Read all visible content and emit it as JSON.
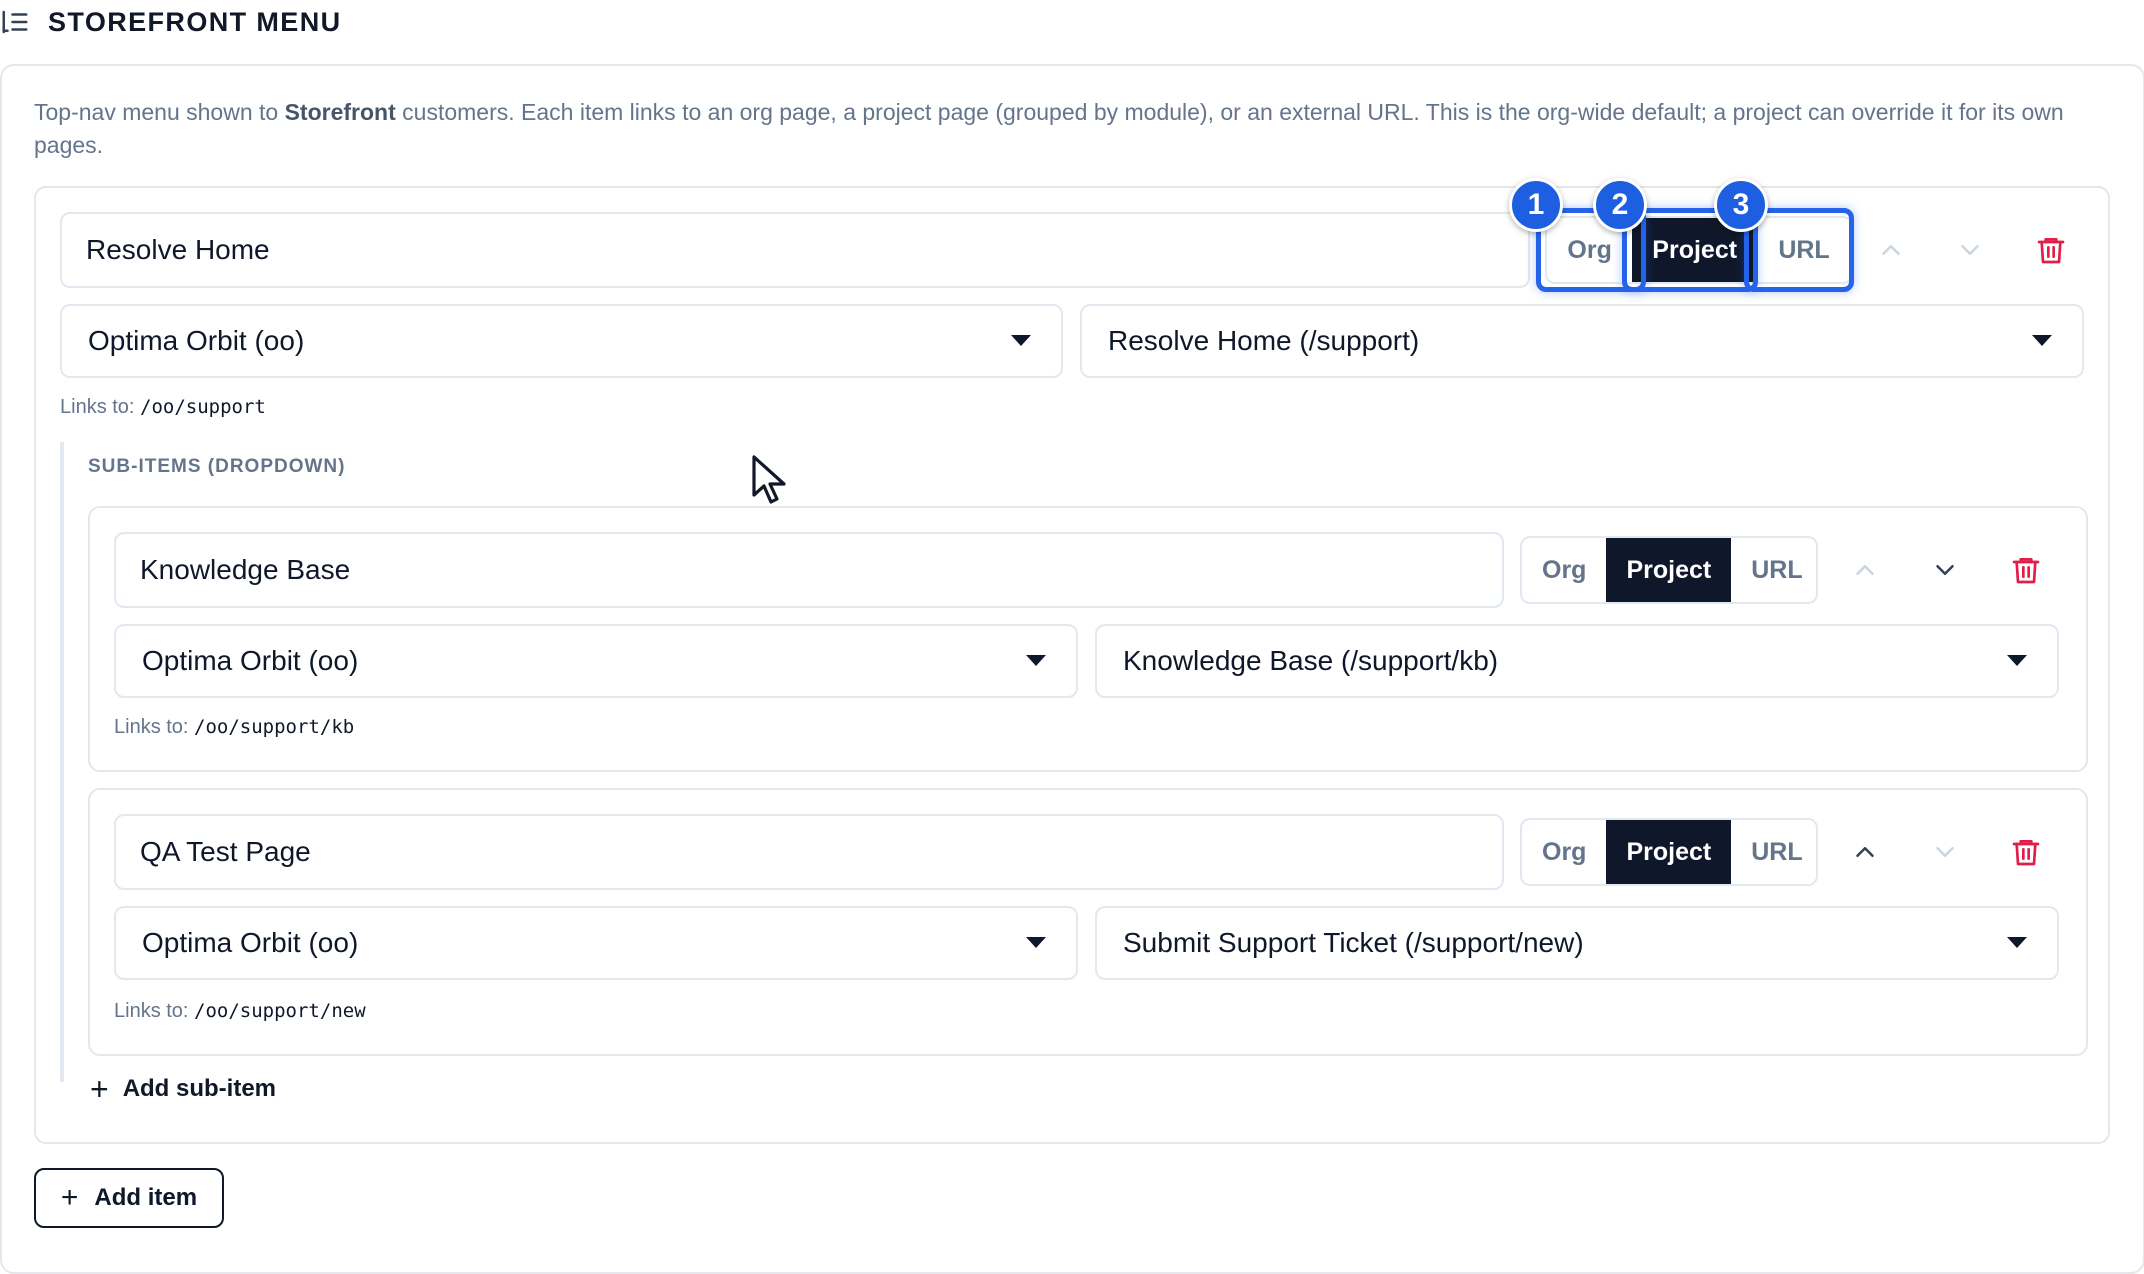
{
  "header": {
    "title": "STOREFRONT MENU",
    "icon": "list-indent-icon"
  },
  "description": {
    "before": "Top-nav menu shown to ",
    "bold": "Storefront",
    "after": " customers. Each item links to an org page, a project page (grouped by module), or an external URL. This is the org-wide default; a project can override it for its own pages."
  },
  "toggle_options": {
    "org": "Org",
    "project": "Project",
    "url": "URL"
  },
  "items": [
    {
      "label_value": "Resolve Home",
      "project_select": "Optima Orbit (oo)",
      "page_select": "Resolve Home (/support)",
      "links_prefix": "Links to:",
      "links_path": "/oo/support",
      "active_type": "Project"
    }
  ],
  "subitems_heading": "SUB-ITEMS (DROPDOWN)",
  "subitems": [
    {
      "label_value": "Knowledge Base",
      "project_select": "Optima Orbit (oo)",
      "page_select": "Knowledge Base (/support/kb)",
      "links_prefix": "Links to:",
      "links_path": "/oo/support/kb",
      "active_type": "Project"
    },
    {
      "label_value": "QA Test Page",
      "project_select": "Optima Orbit (oo)",
      "page_select": "Submit Support Ticket (/support/new)",
      "links_prefix": "Links to:",
      "links_path": "/oo/support/new",
      "active_type": "Project"
    }
  ],
  "add_subitem_label": "Add sub-item",
  "add_item_label": "Add item",
  "annotations": [
    "1",
    "2",
    "3"
  ],
  "colors": {
    "active_toggle": "#0f172a",
    "highlight": "#2563eb",
    "delete": "#e11d48"
  }
}
